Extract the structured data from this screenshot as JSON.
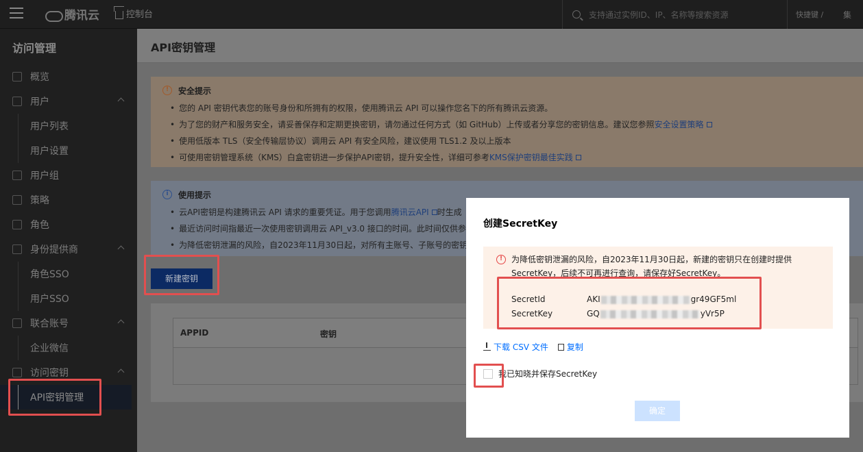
{
  "topbar": {
    "logo_text": "腾讯云",
    "console_label": "控制台",
    "search_placeholder": "支持通过实例ID、IP、名称等搜索资源",
    "shortcut_label": "快捷键 /",
    "end_label": "集"
  },
  "sidebar": {
    "title": "访问管理",
    "items": [
      {
        "label": "概览",
        "icon": "grid-icon"
      },
      {
        "label": "用户",
        "icon": "user-icon"
      },
      {
        "label": "用户列表"
      },
      {
        "label": "用户设置"
      },
      {
        "label": "用户组",
        "icon": "users-icon"
      },
      {
        "label": "策略",
        "icon": "policy-icon"
      },
      {
        "label": "角色",
        "icon": "role-icon"
      },
      {
        "label": "身份提供商",
        "icon": "idp-icon"
      },
      {
        "label": "角色SSO"
      },
      {
        "label": "用户SSO"
      },
      {
        "label": "联合账号",
        "icon": "federation-icon"
      },
      {
        "label": "企业微信"
      },
      {
        "label": "访问密钥",
        "icon": "key-icon"
      },
      {
        "label": "API密钥管理"
      }
    ]
  },
  "main": {
    "title": "API密钥管理",
    "security": {
      "heading": "安全提示",
      "lines": [
        "您的 API 密钥代表您的账号身份和所拥有的权限，使用腾讯云 API 可以操作您名下的所有腾讯云资源。",
        "为了您的财产和服务安全，请妥善保存和定期更换密钥，请勿通过任何方式（如 GitHub）上传或者分享您的密钥信息。建议您参照",
        "使用低版本 TLS（安全传输层协议）调用云 API 有安全风险，建议使用 TLS1.2 及以上版本",
        "可使用密钥管理系统（KMS）白盒密钥进一步保护API密钥，提升安全性，详细可参考"
      ],
      "link1": "安全设置策略",
      "link2": "KMS保护密钥最佳实践"
    },
    "usage": {
      "heading": "使用提示",
      "line1_a": "云API密钥是构建腾讯云 API 请求的重要凭证。用于您调用",
      "line1_link": "腾讯云API",
      "line1_b": "时生成",
      "line2": "最近访问时间指最近一次使用密钥调用云 API_v3.0 接口的时间。此时间仅供参",
      "line3": "为降低密钥泄漏的风险，自2023年11月30日起，对所有主账号、子账号的密钥"
    },
    "create_button": "新建密钥",
    "table": {
      "columns": [
        "APPID",
        "密钥"
      ]
    }
  },
  "modal": {
    "title": "创建SecretKey",
    "warning": "为降低密钥泄漏的风险，自2023年11月30日起，新建的密钥只在创建时提供SecretKey，后续不可再进行查询，请保存好SecretKey。",
    "secret_id_label": "SecretId",
    "secret_id_prefix": "AKI",
    "secret_id_suffix": "gr49GF5ml",
    "secret_key_label": "SecretKey",
    "secret_key_prefix": "GQ",
    "secret_key_suffix": "yVr5P",
    "download_label": "下载 CSV 文件",
    "copy_label": "复制",
    "ack_label": "我已知晓并保存SecretKey",
    "confirm_label": "确定"
  },
  "colors": {
    "highlight": "#e24f4f",
    "link": "#006eff",
    "primary_button": "#0c2a63",
    "disabled_button": "#cce2ff"
  }
}
